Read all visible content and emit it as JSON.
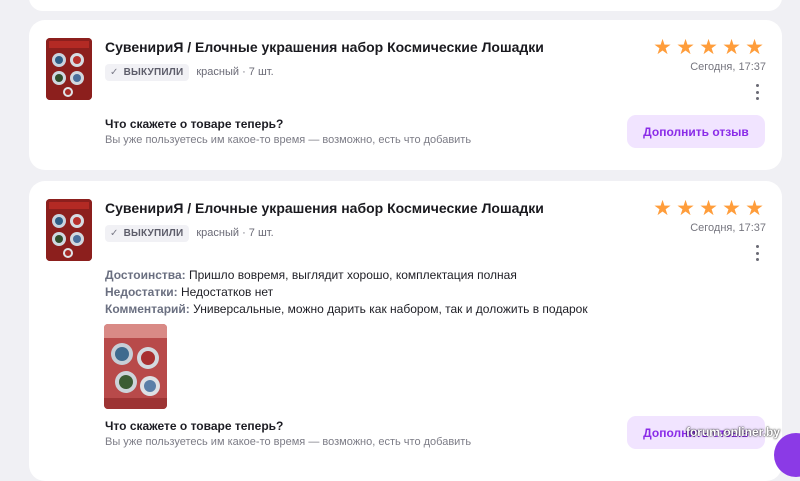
{
  "reviews": [
    {
      "product_title": "СувенириЯ / Елочные украшения набор Космические Лошадки",
      "status_badge": "ВЫКУПИЛИ",
      "variant": "красный · 7 шт.",
      "rating": 5,
      "date": "Сегодня, 17:37",
      "followup_title": "Что скажете о товаре теперь?",
      "followup_subtitle": "Вы уже пользуетесь им какое-то время — возможно, есть что добавить",
      "cta_label": "Дополнить отзыв"
    },
    {
      "product_title": "СувенириЯ / Елочные украшения набор Космические Лошадки",
      "status_badge": "ВЫКУПИЛИ",
      "variant": "красный · 7 шт.",
      "rating": 5,
      "date": "Сегодня, 17:37",
      "pros_label": "Достоинства:",
      "pros": "Пришло вовремя, выглядит хорошо, комплектация полная",
      "cons_label": "Недостатки:",
      "cons": "Недостатков нет",
      "comment_label": "Комментарий:",
      "comment": "Универсальные, можно дарить как набором, так и доложить в подарок",
      "followup_title": "Что скажете о товаре теперь?",
      "followup_subtitle": "Вы уже пользуетесь им какое-то время — возможно, есть что добавить",
      "cta_label": "Дополнить отзыв"
    }
  ],
  "watermark": "forum.onliner.by",
  "icons": {
    "star": "star-icon",
    "check": "check-icon",
    "more": "more-vertical-icon"
  },
  "colors": {
    "accent": "#8a2ce8",
    "accent_bg": "#f1e4ff",
    "star": "#ff9d3b",
    "page_bg": "#f0f0f4"
  }
}
